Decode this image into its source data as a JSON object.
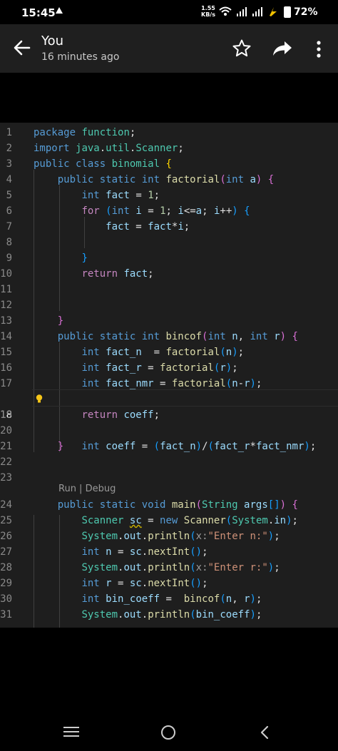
{
  "status_bar": {
    "time": "15:45",
    "speed": "1.55",
    "speed_unit": "KB/s",
    "battery": "72%"
  },
  "header": {
    "title": "You",
    "subtitle": "16 minutes ago"
  },
  "code_editor": {
    "active_line": "18",
    "codelens": "Run | Debug",
    "line_numbers": [
      "1",
      "2",
      "3",
      "4",
      "5",
      "6",
      "7",
      "8",
      "9",
      "10",
      "11",
      "12",
      "13",
      "14",
      "15",
      "16",
      "17",
      "18",
      "19",
      "20",
      "21",
      "22",
      "23",
      "24",
      "25",
      "26",
      "27",
      "28",
      "29",
      "30",
      "31"
    ],
    "lines": [
      "package function;",
      "import java.util.Scanner;",
      "public class binomial {",
      "    public static int factorial(int a) {",
      "        int fact = 1;",
      "        for (int i = 1; i<=a; i++) {",
      "            fact = fact*i;",
      "",
      "        }",
      "        return fact;",
      "",
      "",
      "    }",
      "    public static int bincof(int n, int r) {",
      "        int fact_n  = factorial(n);",
      "        int fact_r = factorial(r);",
      "        int fact_nmr = factorial(n-r);",
      "        int coeff = (fact_n)/(fact_r*fact_nmr);",
      "        return coeff;",
      "",
      "    }",
      "",
      "",
      "    public static void main(String args[]) {",
      "        Scanner sc = new Scanner(System.in);",
      "        System.out.println(x:\"Enter n:\");",
      "        int n = sc.nextInt();",
      "        System.out.println(x:\"Enter r:\");",
      "        int r = sc.nextInt();",
      "        int bin_coeff =  bincof(n, r);",
      "        System.out.println(bin_coeff);"
    ]
  }
}
